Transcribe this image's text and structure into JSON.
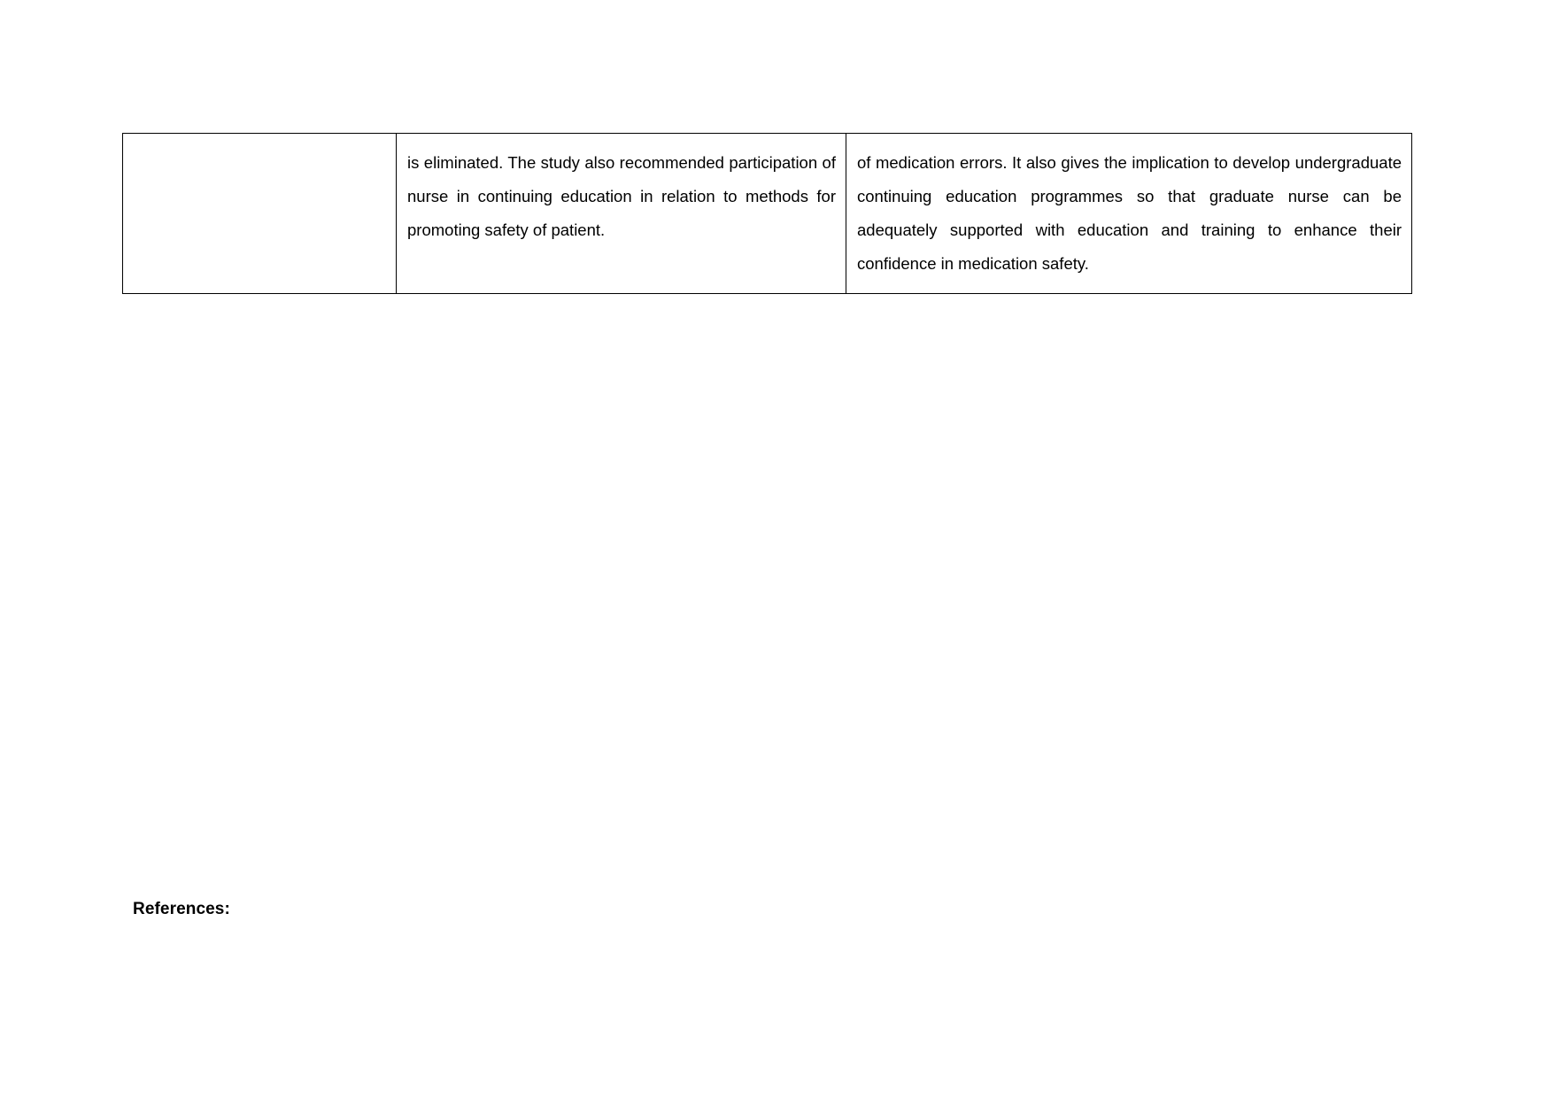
{
  "document": {
    "table": {
      "rows": [
        {
          "cells": [
            {
              "name": "cell-left-empty",
              "text": ""
            },
            {
              "name": "cell-middle-findings",
              "text": "is eliminated. The study also recommended participation of nurse in continuing education in relation to methods for promoting safety of patient."
            },
            {
              "name": "cell-right-implications",
              "text": "of medication errors. It also gives the implication to develop undergraduate continuing education programmes so that graduate nurse can be adequately supported with education and training to enhance their confidence in medication safety."
            }
          ]
        }
      ]
    },
    "references_heading": "References:"
  },
  "colors": {
    "page_background": "#ffffff",
    "text": "#000000",
    "table_border": "#000000"
  }
}
